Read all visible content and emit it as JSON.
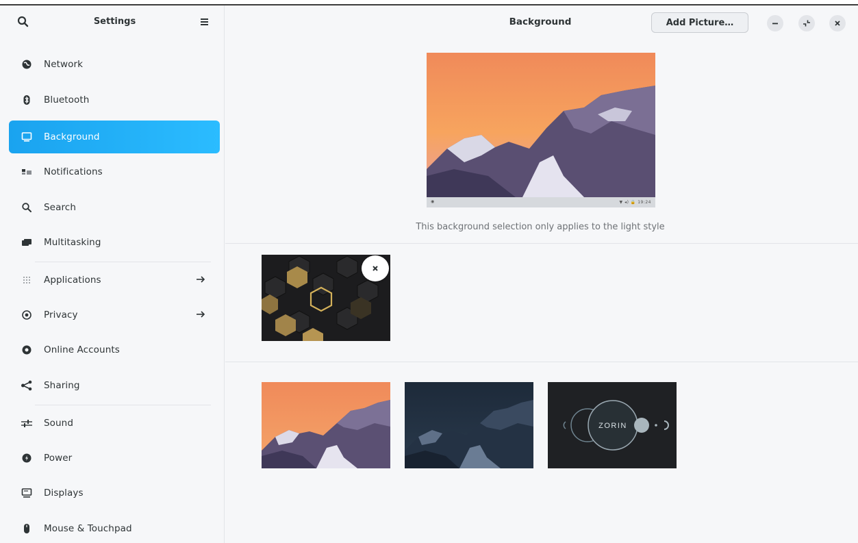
{
  "sidebar": {
    "title": "Settings",
    "search_icon": "search-icon",
    "menu_icon": "hamburger-menu-icon",
    "items": [
      {
        "label": "Network",
        "icon": "globe-icon"
      },
      {
        "label": "Bluetooth",
        "icon": "bluetooth-icon"
      },
      {
        "label": "Background",
        "icon": "monitor-icon",
        "active": true
      },
      {
        "label": "Notifications",
        "icon": "notifications-icon"
      },
      {
        "label": "Search",
        "icon": "search-icon"
      },
      {
        "label": "Multitasking",
        "icon": "multitasking-icon"
      },
      {
        "label": "Applications",
        "icon": "grid-icon",
        "arrow": true
      },
      {
        "label": "Privacy",
        "icon": "privacy-icon",
        "arrow": true
      },
      {
        "label": "Online Accounts",
        "icon": "online-accounts-icon"
      },
      {
        "label": "Sharing",
        "icon": "share-icon"
      },
      {
        "label": "Sound",
        "icon": "sound-icon"
      },
      {
        "label": "Power",
        "icon": "power-icon"
      },
      {
        "label": "Displays",
        "icon": "display-icon"
      },
      {
        "label": "Mouse & Touchpad",
        "icon": "mouse-icon"
      }
    ]
  },
  "main": {
    "title": "Background",
    "add_picture_label": "Add Picture…",
    "window_controls": [
      "minimize-icon",
      "restore-icon",
      "close-icon"
    ],
    "preview_bar_right": "▼ ◂) 🔒 19:24",
    "caption": "This background selection only applies to the light style",
    "custom_wallpapers": [
      {
        "name": "gold-hexagons",
        "removable": true
      }
    ],
    "default_wallpapers": [
      {
        "name": "mountains-sunset"
      },
      {
        "name": "mountains-night"
      },
      {
        "name": "zorin-logo",
        "text": "ZORIN"
      }
    ]
  },
  "colors": {
    "accent": "#1aa3ef",
    "sidebar_bg": "#f6f7f9",
    "text": "#2e3436",
    "muted_text": "#6d7175"
  }
}
